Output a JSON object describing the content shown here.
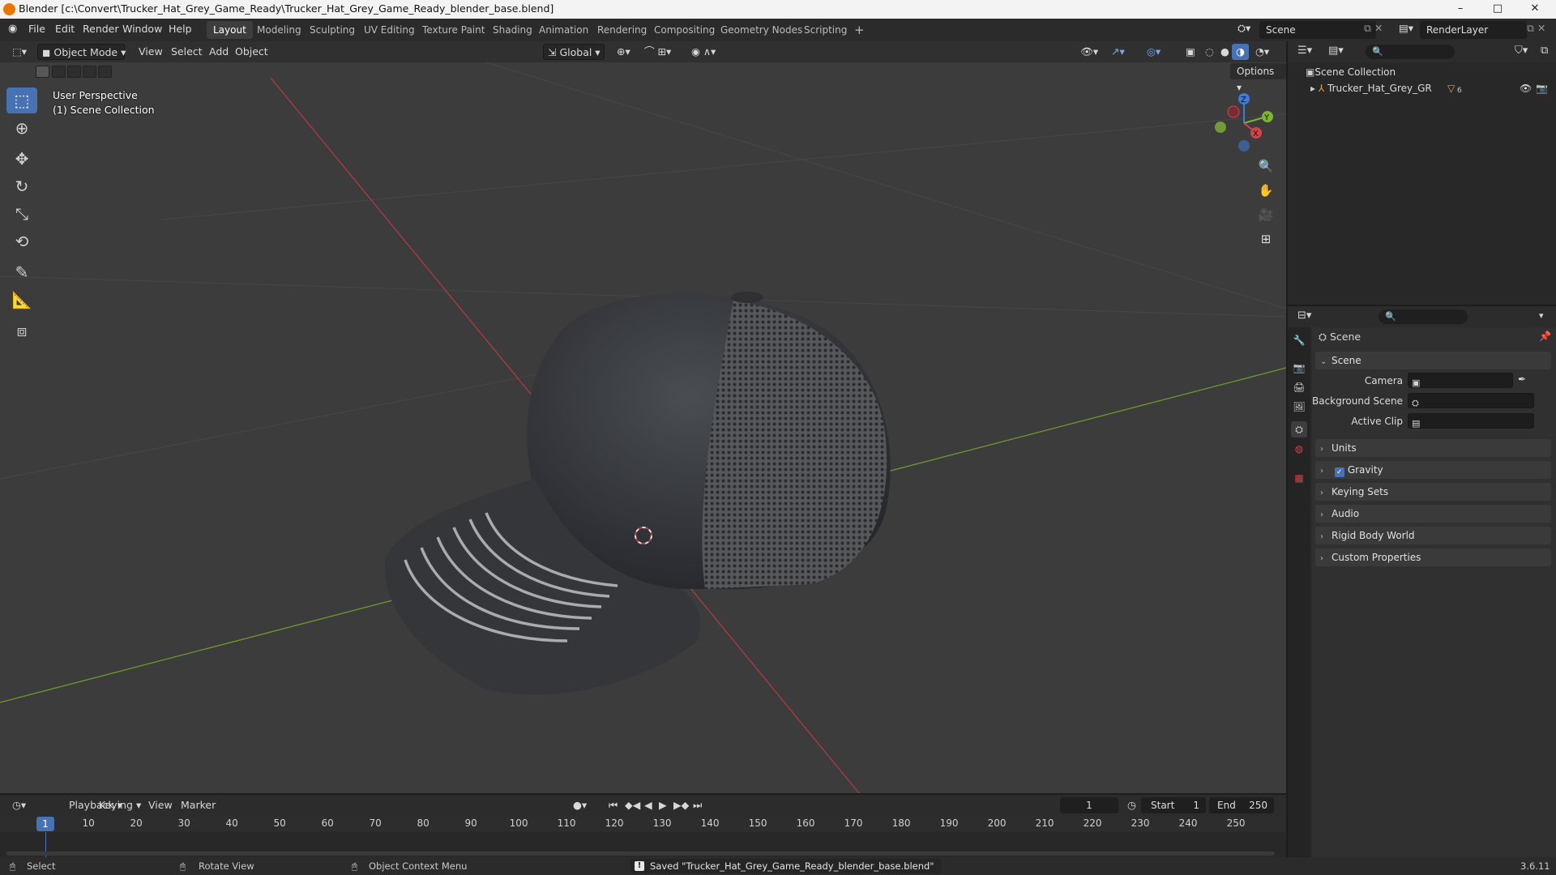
{
  "window": {
    "title": "Blender [c:\\Convert\\Trucker_Hat_Grey_Game_Ready\\Trucker_Hat_Grey_Game_Ready_blender_base.blend]",
    "minimize": "–",
    "maximize": "□",
    "close": "✕"
  },
  "menu": [
    "File",
    "Edit",
    "Render",
    "Window",
    "Help"
  ],
  "workspaces": [
    "Layout",
    "Modeling",
    "Sculpting",
    "UV Editing",
    "Texture Paint",
    "Shading",
    "Animation",
    "Rendering",
    "Compositing",
    "Geometry Nodes",
    "Scripting"
  ],
  "active_workspace": "Layout",
  "add_workspace": "+",
  "scene_name": "Scene",
  "view_layer": "RenderLayer",
  "viewport": {
    "mode": "Object Mode",
    "menus": [
      "View",
      "Select",
      "Add",
      "Object"
    ],
    "orientation": "Global",
    "options": "Options",
    "overlay_line1": "User Perspective",
    "overlay_line2": "(1) Scene Collection",
    "gizmo_axes": [
      "Z",
      "Y",
      "X"
    ]
  },
  "outliner": {
    "root": "Scene Collection",
    "items": [
      {
        "name": "Trucker_Hat_Grey_GR",
        "badge": "6"
      }
    ]
  },
  "properties": {
    "header_title": "Scene",
    "section": "Scene",
    "fields": [
      {
        "label": "Camera",
        "value": ""
      },
      {
        "label": "Background Scene",
        "value": ""
      },
      {
        "label": "Active Clip",
        "value": ""
      }
    ],
    "panels": [
      "Units",
      "Gravity",
      "Keying Sets",
      "Audio",
      "Rigid Body World",
      "Custom Properties"
    ],
    "gravity_checked": true
  },
  "timeline": {
    "menus": [
      "Playback",
      "Keying",
      "View",
      "Marker"
    ],
    "current_frame": "1",
    "start_label": "Start",
    "start": "1",
    "end_label": "End",
    "end": "250",
    "ticks": [
      "10",
      "20",
      "30",
      "40",
      "50",
      "60",
      "70",
      "80",
      "90",
      "100",
      "110",
      "120",
      "130",
      "140",
      "150",
      "160",
      "170",
      "180",
      "190",
      "200",
      "210",
      "220",
      "230",
      "240",
      "250"
    ]
  },
  "statusbar": {
    "select": "Select",
    "rotate": "Rotate View",
    "context": "Object Context Menu",
    "message": "Saved \"Trucker_Hat_Grey_Game_Ready_blender_base.blend\"",
    "version": "3.6.11"
  },
  "colors": {
    "accent": "#4772b3",
    "x_axis": "#d0454c",
    "y_axis": "#7fb332",
    "z_axis": "#3d7dd8",
    "viewport_bg": "#3c3c3c"
  }
}
